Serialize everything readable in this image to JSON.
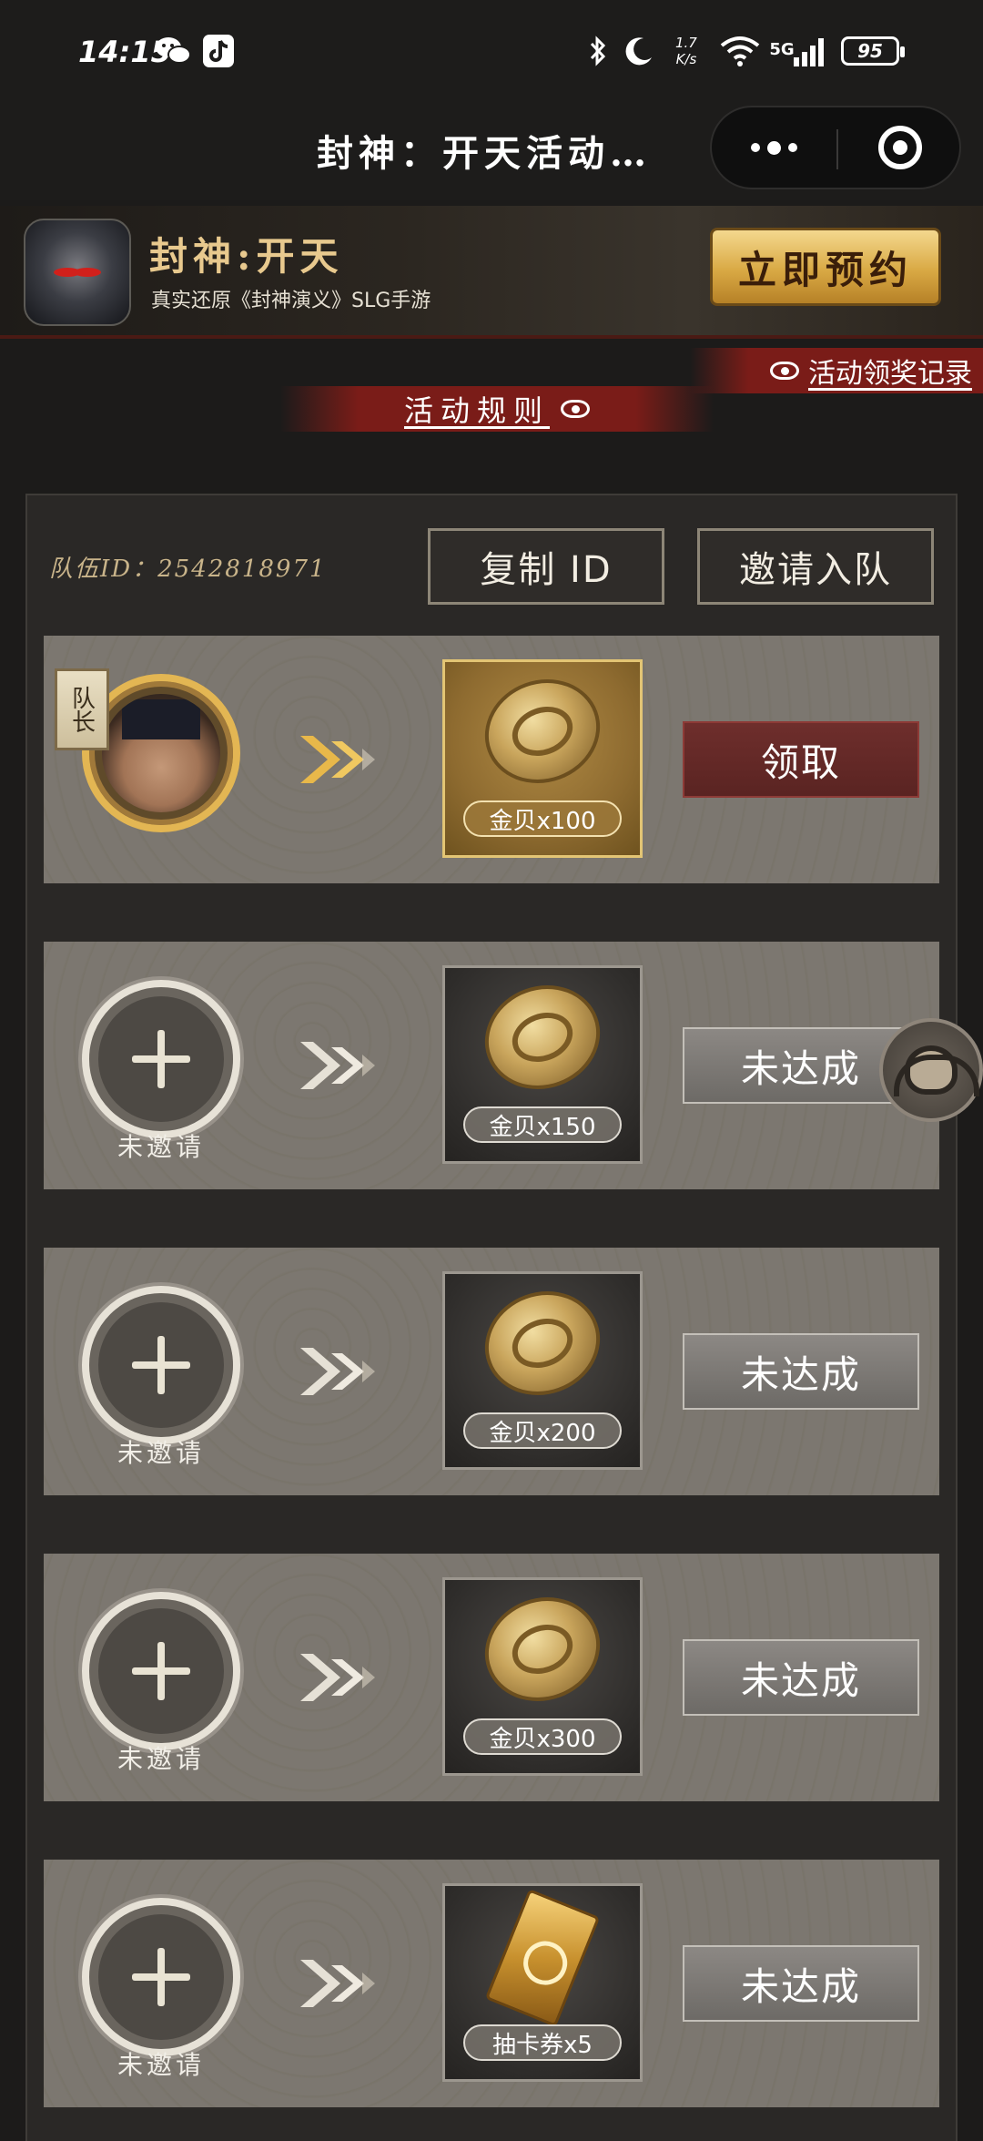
{
  "status_bar": {
    "time": "14:15",
    "speed_value": "1.7",
    "speed_unit": "K/s",
    "network": "5G",
    "battery": "95",
    "icons": [
      "wechat-icon",
      "tiktok-icon",
      "bluetooth-icon",
      "moon-icon",
      "wifi-icon",
      "signal-icon",
      "battery-icon"
    ]
  },
  "title_bar": {
    "title": "封神：开天活动…"
  },
  "banner": {
    "game_title": "封神:开天",
    "subtitle": "真实还原《封神演义》SLG手游",
    "reserve_label": "立即预约"
  },
  "links": {
    "record_label": "活动领奖记录",
    "rules_label": "活动规则"
  },
  "team": {
    "id_label": "队伍ID：",
    "id_value": "2542818971",
    "copy_label": "复制 ID",
    "invite_label": "邀请入队"
  },
  "rows": [
    {
      "state": "captain",
      "captain_tag": "队长",
      "reward_label": "金贝x100",
      "action_label": "领取"
    },
    {
      "state": "empty",
      "slot_label": "未邀请",
      "reward_label": "金贝x150",
      "action_label": "未达成"
    },
    {
      "state": "empty",
      "slot_label": "未邀请",
      "reward_label": "金贝x200",
      "action_label": "未达成"
    },
    {
      "state": "empty",
      "slot_label": "未邀请",
      "reward_label": "金贝x300",
      "action_label": "未达成"
    },
    {
      "state": "empty",
      "slot_label": "未邀请",
      "reward_label": "抽卡券x5",
      "action_label": "未达成"
    }
  ],
  "colors": {
    "background": "#1c1b1a",
    "accent_gold": "#e3b653",
    "accent_red": "#7a1c18",
    "row_bg": "#7b766f"
  }
}
